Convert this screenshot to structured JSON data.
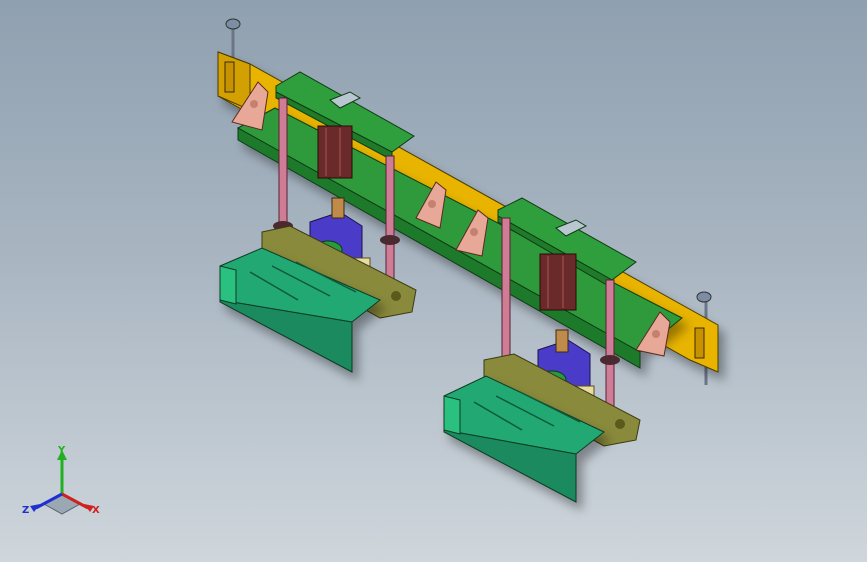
{
  "view": {
    "background_top": "#8fa0b0",
    "background_bottom": "#cfd6dc"
  },
  "colors": {
    "yellow_beam": "#e8b400",
    "green_plate": "#2d9a3a",
    "gusset_pink": "#e8a898",
    "rod_pink": "#cf7c96",
    "cylinder_dark": "#6b2a2a",
    "blue_block": "#4a3cc8",
    "teal_tray": "#22a873",
    "olive_base": "#8a8a3c",
    "bolt_steel": "#7c8ea4"
  },
  "triad": {
    "x_label": "X",
    "y_label": "Y",
    "z_label": "Z",
    "x_color": "#d02020",
    "y_color": "#20b020",
    "z_color": "#2030d0"
  },
  "model": {
    "name": "fixture-assembly",
    "modules": [
      "left-module",
      "right-module"
    ]
  }
}
